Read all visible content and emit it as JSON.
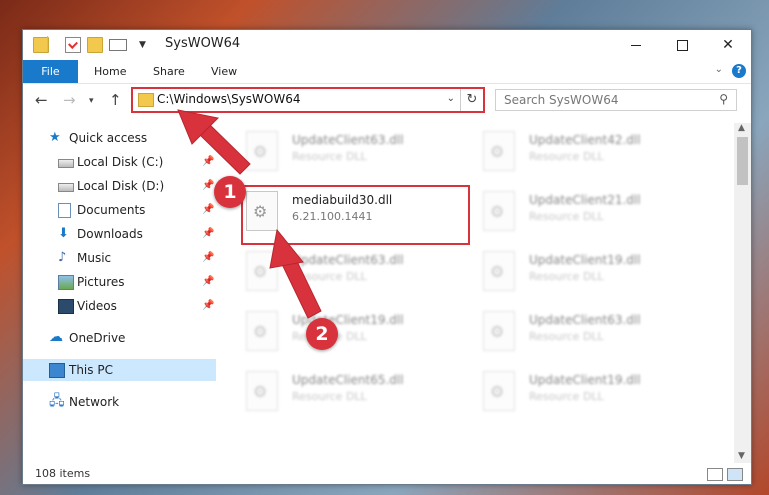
{
  "window": {
    "title": "SysWOW64",
    "min_icon": "minimize-icon",
    "max_icon": "maximize-icon",
    "close_glyph": "✕"
  },
  "ribbon": {
    "tabs": [
      "File",
      "Home",
      "Share",
      "View"
    ],
    "help_glyph": "?"
  },
  "address": {
    "path": "C:\\Windows\\SysWOW64",
    "search_placeholder": "Search SysWOW64"
  },
  "nav_pane": {
    "items": [
      {
        "label": "Quick access",
        "icon": "star-icon"
      },
      {
        "label": "Local Disk (C:)",
        "icon": "drive-icon"
      },
      {
        "label": "Local Disk (D:)",
        "icon": "drive-icon"
      },
      {
        "label": "Documents",
        "icon": "documents-icon"
      },
      {
        "label": "Downloads",
        "icon": "downloads-icon"
      },
      {
        "label": "Music",
        "icon": "music-icon"
      },
      {
        "label": "Pictures",
        "icon": "pictures-icon"
      },
      {
        "label": "Videos",
        "icon": "videos-icon"
      },
      {
        "label": "OneDrive",
        "icon": "onedrive-icon"
      },
      {
        "label": "This PC",
        "icon": "this-pc-icon"
      },
      {
        "label": "Network",
        "icon": "network-icon"
      }
    ]
  },
  "files": [
    {
      "name": "UpdateClient63.dll",
      "sub": "Resource DLL"
    },
    {
      "name": "UpdateClient42.dll",
      "sub": "Resource DLL"
    },
    {
      "name": "mediabuild30.dll",
      "sub": "6.21.100.1441"
    },
    {
      "name": "UpdateClient21.dll",
      "sub": "Resource DLL"
    },
    {
      "name": "UpdateClient63.dll",
      "sub": "Resource DLL"
    },
    {
      "name": "UpdateClient19.dll",
      "sub": "Resource DLL"
    },
    {
      "name": "UpdateClient19.dll",
      "sub": "Resource DLL"
    },
    {
      "name": "UpdateClient63.dll",
      "sub": "Resource DLL"
    },
    {
      "name": "UpdateClient65.dll",
      "sub": "Resource DLL"
    },
    {
      "name": "UpdateClient19.dll",
      "sub": "Resource DLL"
    }
  ],
  "status": {
    "item_count": "108 items"
  },
  "callouts": {
    "step1": "1",
    "step2": "2"
  },
  "colors": {
    "accent": "#1979ca",
    "highlight": "#d8323d"
  }
}
